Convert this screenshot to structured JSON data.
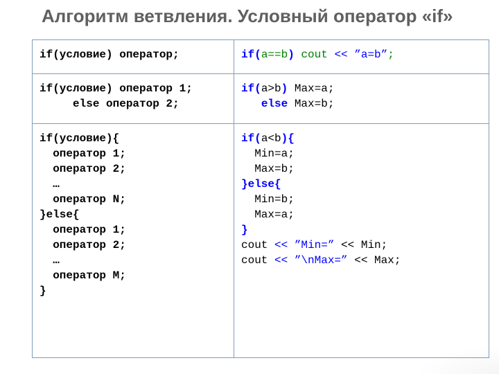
{
  "title": "Алгоритм ветвления. Условный оператор «if»",
  "rows": [
    {
      "left": [
        [
          {
            "t": "if(условие) оператор;",
            "cls": "b"
          }
        ]
      ],
      "right": [
        [
          {
            "t": "if(",
            "cls": "b blue"
          },
          {
            "t": "a==b",
            "cls": "green"
          },
          {
            "t": ")",
            "cls": "b blue"
          },
          {
            "t": " cout ",
            "cls": "green"
          },
          {
            "t": "<< ”a=b”",
            "cls": "blue"
          },
          {
            "t": ";",
            "cls": "green"
          }
        ]
      ]
    },
    {
      "left": [
        [
          {
            "t": "if(условие) оператор 1;",
            "cls": "b"
          }
        ],
        [
          {
            "t": "     else оператор 2;",
            "cls": "b"
          }
        ]
      ],
      "right": [
        [
          {
            "t": "if(",
            "cls": "b blue"
          },
          {
            "t": "a>b",
            "cls": ""
          },
          {
            "t": ")",
            "cls": "b blue"
          },
          {
            "t": " Max=a;",
            "cls": ""
          }
        ],
        [
          {
            "t": "   ",
            "cls": ""
          },
          {
            "t": "else",
            "cls": "b blue"
          },
          {
            "t": " Max=b;",
            "cls": ""
          }
        ]
      ]
    },
    {
      "left": [
        [
          {
            "t": "if(условие){",
            "cls": "b"
          }
        ],
        [
          {
            "t": "  оператор 1;",
            "cls": "b"
          }
        ],
        [
          {
            "t": "  оператор 2;",
            "cls": "b"
          }
        ],
        [
          {
            "t": "  …",
            "cls": "b"
          }
        ],
        [
          {
            "t": "  оператор N;",
            "cls": "b"
          }
        ],
        [
          {
            "t": "}else{",
            "cls": "b"
          }
        ],
        [
          {
            "t": "  оператор 1;",
            "cls": "b"
          }
        ],
        [
          {
            "t": "  оператор 2;",
            "cls": "b"
          }
        ],
        [
          {
            "t": "  …",
            "cls": "b"
          }
        ],
        [
          {
            "t": "  оператор M;",
            "cls": "b"
          }
        ],
        [
          {
            "t": "}",
            "cls": "b"
          }
        ]
      ],
      "right": [
        [
          {
            "t": "if(",
            "cls": "b blue"
          },
          {
            "t": "a<b",
            "cls": ""
          },
          {
            "t": "){",
            "cls": "b blue"
          }
        ],
        [
          {
            "t": "  Min=a;",
            "cls": ""
          }
        ],
        [
          {
            "t": "  Max=b;",
            "cls": ""
          }
        ],
        [
          {
            "t": "}else{",
            "cls": "b blue"
          }
        ],
        [
          {
            "t": "  Min=b;",
            "cls": ""
          }
        ],
        [
          {
            "t": "  Max=a;",
            "cls": ""
          }
        ],
        [
          {
            "t": "}",
            "cls": "b blue"
          }
        ],
        [
          {
            "t": "cout ",
            "cls": ""
          },
          {
            "t": "<< ”Min=”",
            "cls": "blue"
          },
          {
            "t": " << Min;",
            "cls": ""
          }
        ],
        [
          {
            "t": "cout ",
            "cls": ""
          },
          {
            "t": "<< ”\\nMax=”",
            "cls": "blue"
          },
          {
            "t": " << Max;",
            "cls": ""
          }
        ]
      ]
    }
  ]
}
